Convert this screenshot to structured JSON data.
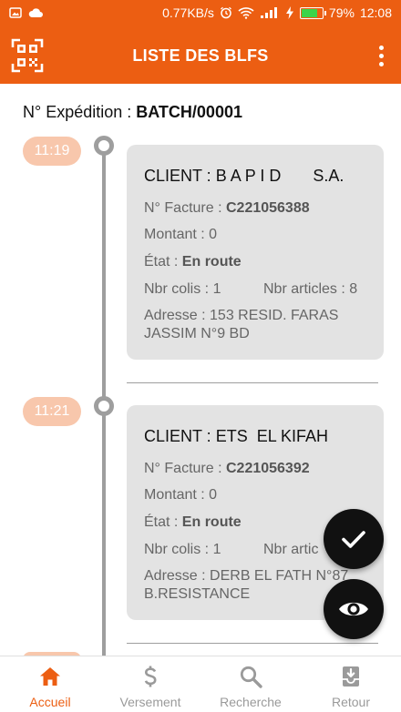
{
  "status_bar": {
    "speed": "0.77KB/s",
    "battery": "79%",
    "battery_level": 0.79,
    "time": "12:08",
    "icons": [
      "image-icon",
      "cloud-icon",
      "alarm-icon",
      "wifi-icon",
      "signal-icon",
      "charging-icon",
      "battery-icon"
    ]
  },
  "appbar": {
    "title": "LISTE DES BLFS",
    "icons": [
      "qr-scan-icon",
      "more-vertical-icon"
    ]
  },
  "expedition": {
    "label": "N° Expédition : ",
    "value": "BATCH/00001"
  },
  "entries": [
    {
      "time": "11:19",
      "client": "CLIENT : B A P I D       S.A.",
      "facture_label": "N° Facture : ",
      "facture": "C221056388",
      "montant": "Montant : 0",
      "etat_label": "État : ",
      "etat": "En route",
      "colis": "Nbr colis : 1",
      "articles": "Nbr articles : 8",
      "adresse": "Adresse : 153 RESID. FARAS JASSIM N°9 BD"
    },
    {
      "time": "11:21",
      "client": "CLIENT : ETS  EL KIFAH",
      "facture_label": "N° Facture : ",
      "facture": "C221056392",
      "montant": "Montant : 0",
      "etat_label": "État : ",
      "etat": "En route",
      "colis": "Nbr colis : 1",
      "articles": "Nbr artic",
      "adresse": "Adresse : DERB EL FATH N°87 B.RESISTANCE"
    }
  ],
  "fabs": [
    "check-icon",
    "eye-icon"
  ],
  "bottom_nav": {
    "active_color": "#ec5e12",
    "items": [
      {
        "label": "Accueil",
        "icon": "home-icon",
        "active": true
      },
      {
        "label": "Versement",
        "icon": "dollar-icon",
        "active": false
      },
      {
        "label": "Recherche",
        "icon": "search-icon",
        "active": false
      },
      {
        "label": "Retour",
        "icon": "return-box-icon",
        "active": false
      }
    ]
  },
  "colors": {
    "primary": "#ec5e12",
    "time_pill": "#f8c7ac",
    "card": "#e3e3e3",
    "timeline": "#9e9e9e",
    "fab": "#111111"
  }
}
